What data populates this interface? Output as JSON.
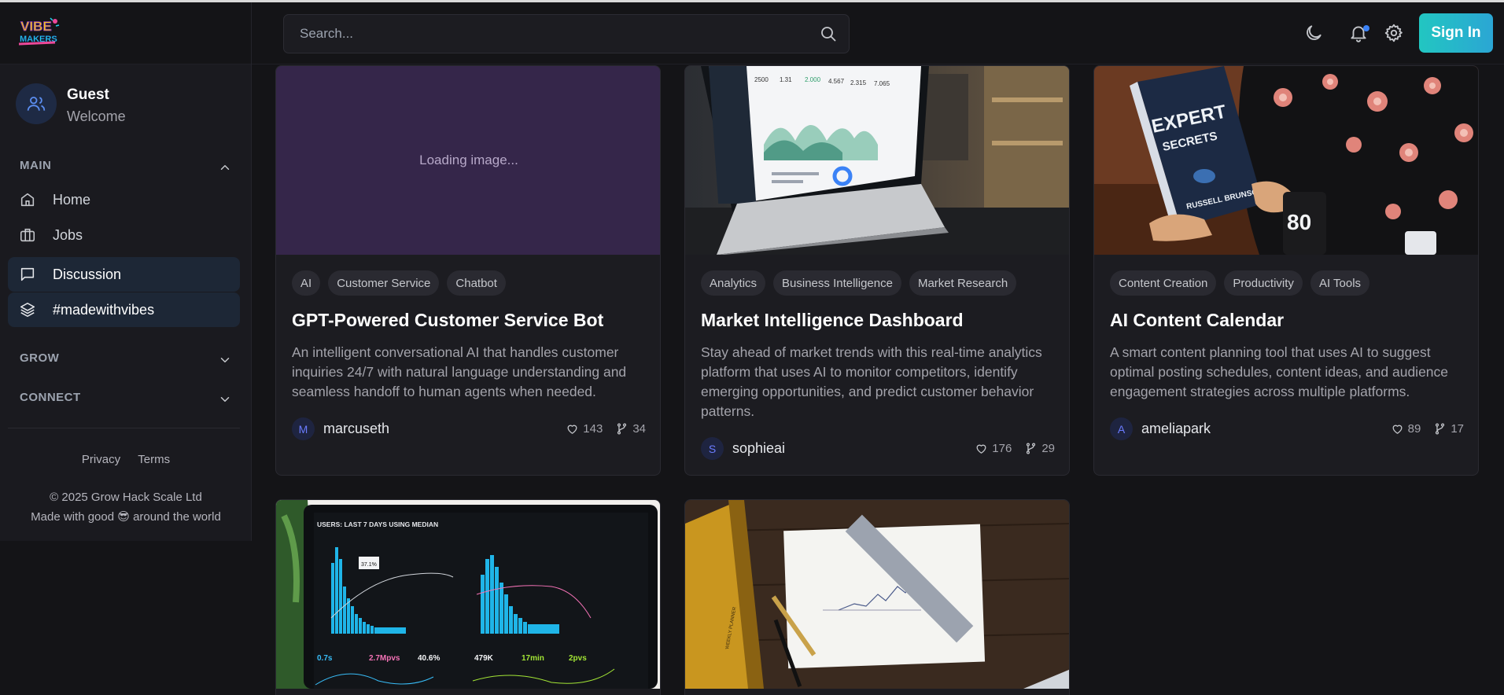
{
  "header": {
    "search_placeholder": "Search...",
    "signin_label": "Sign In"
  },
  "user": {
    "name": "Guest",
    "subtitle": "Welcome"
  },
  "nav": {
    "main_label": "MAIN",
    "items": [
      {
        "label": "Home",
        "icon": "home-icon"
      },
      {
        "label": "Jobs",
        "icon": "briefcase-icon"
      },
      {
        "label": "Discussion",
        "icon": "message-icon"
      },
      {
        "label": "#madewithvibes",
        "icon": "layers-icon"
      }
    ],
    "grow_label": "GROW",
    "connect_label": "CONNECT"
  },
  "footer": {
    "privacy": "Privacy",
    "terms": "Terms",
    "copyright": "© 2025 Grow Hack Scale Ltd",
    "made_prefix": "Made with good",
    "made_emoji": "😎",
    "made_suffix": "around the world"
  },
  "cards": [
    {
      "image_text": "Loading image...",
      "tags": [
        "AI",
        "Customer Service",
        "Chatbot"
      ],
      "title": "GPT-Powered Customer Service Bot",
      "description": "An intelligent conversational AI that handles customer inquiries 24/7 with natural language understanding and seamless handoff to human agents when needed.",
      "author_initial": "M",
      "author": "marcuseth",
      "likes": "143",
      "forks": "34"
    },
    {
      "tags": [
        "Analytics",
        "Business Intelligence",
        "Market Research"
      ],
      "title": "Market Intelligence Dashboard",
      "description": "Stay ahead of market trends with this real-time analytics platform that uses AI to monitor competitors, identify emerging opportunities, and predict customer behavior patterns.",
      "author_initial": "S",
      "author": "sophieai",
      "likes": "176",
      "forks": "29"
    },
    {
      "tags": [
        "Content Creation",
        "Productivity",
        "AI Tools"
      ],
      "title": "AI Content Calendar",
      "description": "A smart content planning tool that uses AI to suggest optimal posting schedules, content ideas, and audience engagement strategies across multiple platforms.",
      "author_initial": "A",
      "author": "ameliapark",
      "likes": "89",
      "forks": "17"
    }
  ],
  "images": {
    "laptop_dashboard": {
      "numbers": [
        "2500",
        "1.31",
        "2.000",
        "4.567",
        "2.315",
        "7.065"
      ]
    },
    "book": {
      "title_line1": "EXPERT",
      "title_line2": "SECRETS",
      "author": "RUSSELL BRUNSON",
      "mug": "80"
    },
    "analytics_screen": {
      "heading": "USERS: LAST 7 DAYS USING MEDIAN",
      "metrics": [
        "0.7s",
        "2.7Mpvs",
        "40.6%",
        "479K",
        "17min",
        "2pvs"
      ],
      "tooltip": "37.1%"
    },
    "desk": {
      "notebook_label": "WEEKLY PLANNER"
    }
  },
  "colors": {
    "accent_gradient_start": "#22c6c1",
    "accent_gradient_end": "#2ba6d4",
    "notification_dot": "#3b82f6"
  }
}
